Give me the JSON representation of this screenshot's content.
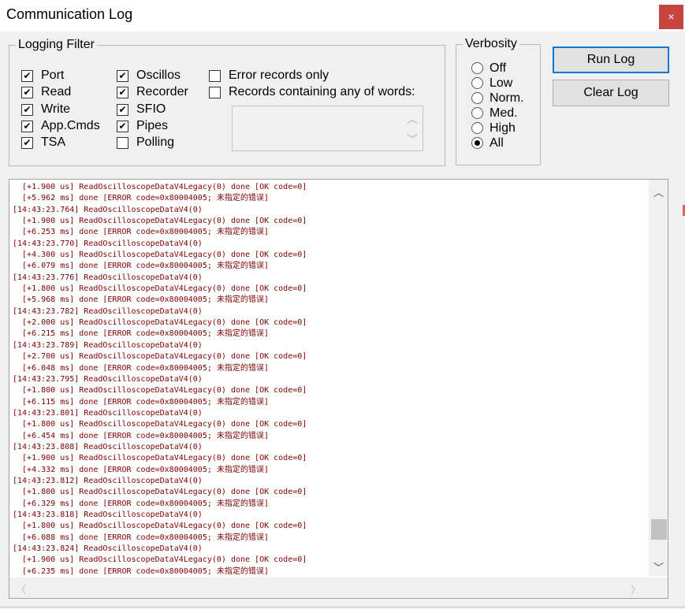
{
  "window": {
    "title": "Communication Log",
    "close_glyph": "×"
  },
  "logging_filter": {
    "title": "Logging Filter",
    "checkboxes": [
      {
        "label": "Port",
        "checked": true
      },
      {
        "label": "Read",
        "checked": true
      },
      {
        "label": "Write",
        "checked": true
      },
      {
        "label": "App.Cmds",
        "checked": true
      },
      {
        "label": "TSA",
        "checked": true
      },
      {
        "label": "Oscillos",
        "checked": true
      },
      {
        "label": "Recorder",
        "checked": true
      },
      {
        "label": "SFIO",
        "checked": true
      },
      {
        "label": "Pipes",
        "checked": true
      },
      {
        "label": "Polling",
        "checked": false
      },
      {
        "label": "Error records only",
        "checked": false
      },
      {
        "label": "Records containing any of words:",
        "checked": false
      }
    ],
    "words_input_value": ""
  },
  "verbosity": {
    "title": "Verbosity",
    "options": [
      "Off",
      "Low",
      "Norm.",
      "Med.",
      "High",
      "All"
    ],
    "selected": "All"
  },
  "buttons": {
    "run_log": "Run Log",
    "clear_log": "Clear Log"
  },
  "log": {
    "lines": [
      "  [+1.900 us] ReadOscilloscopeDataV4Legacy(0) done [OK code=0]",
      "  [+5.962 ms] done [ERROR code=0x80004005; 未指定的错误]",
      "[14:43:23.764] ReadOscilloscopeDataV4(0)",
      "  [+1.900 us] ReadOscilloscopeDataV4Legacy(0) done [OK code=0]",
      "  [+6.253 ms] done [ERROR code=0x80004005; 未指定的错误]",
      "[14:43:23.770] ReadOscilloscopeDataV4(0)",
      "  [+4.300 us] ReadOscilloscopeDataV4Legacy(0) done [OK code=0]",
      "  [+6.079 ms] done [ERROR code=0x80004005; 未指定的错误]",
      "[14:43:23.776] ReadOscilloscopeDataV4(0)",
      "  [+1.800 us] ReadOscilloscopeDataV4Legacy(0) done [OK code=0]",
      "  [+5.968 ms] done [ERROR code=0x80004005; 未指定的错误]",
      "[14:43:23.782] ReadOscilloscopeDataV4(0)",
      "  [+2.000 us] ReadOscilloscopeDataV4Legacy(0) done [OK code=0]",
      "  [+6.215 ms] done [ERROR code=0x80004005; 未指定的错误]",
      "[14:43:23.789] ReadOscilloscopeDataV4(0)",
      "  [+2.700 us] ReadOscilloscopeDataV4Legacy(0) done [OK code=0]",
      "  [+6.048 ms] done [ERROR code=0x80004005; 未指定的错误]",
      "[14:43:23.795] ReadOscilloscopeDataV4(0)",
      "  [+1.800 us] ReadOscilloscopeDataV4Legacy(0) done [OK code=0]",
      "  [+6.115 ms] done [ERROR code=0x80004005; 未指定的错误]",
      "[14:43:23.801] ReadOscilloscopeDataV4(0)",
      "  [+1.800 us] ReadOscilloscopeDataV4Legacy(0) done [OK code=0]",
      "  [+6.454 ms] done [ERROR code=0x80004005; 未指定的错误]",
      "[14:43:23.808] ReadOscilloscopeDataV4(0)",
      "  [+1.900 us] ReadOscilloscopeDataV4Legacy(0) done [OK code=0]",
      "  [+4.332 ms] done [ERROR code=0x80004005; 未指定的错误]",
      "[14:43:23.812] ReadOscilloscopeDataV4(0)",
      "  [+1.800 us] ReadOscilloscopeDataV4Legacy(0) done [OK code=0]",
      "  [+6.329 ms] done [ERROR code=0x80004005; 未指定的错误]",
      "[14:43:23.818] ReadOscilloscopeDataV4(0)",
      "  [+1.800 us] ReadOscilloscopeDataV4Legacy(0) done [OK code=0]",
      "  [+6.088 ms] done [ERROR code=0x80004005; 未指定的错误]",
      "[14:43:23.824] ReadOscilloscopeDataV4(0)",
      "  [+1.900 us] ReadOscilloscopeDataV4Legacy(0) done [OK code=0]",
      "  [+6.235 ms] done [ERROR code=0x80004005; 未指定的错误]"
    ],
    "text_color": "#800000",
    "scroll_position": 0.95
  },
  "icons": {
    "scroll_up": "chevron-up-icon",
    "scroll_down": "chevron-down-icon",
    "scroll_left": "chevron-left-icon",
    "scroll_right": "chevron-right-icon"
  }
}
